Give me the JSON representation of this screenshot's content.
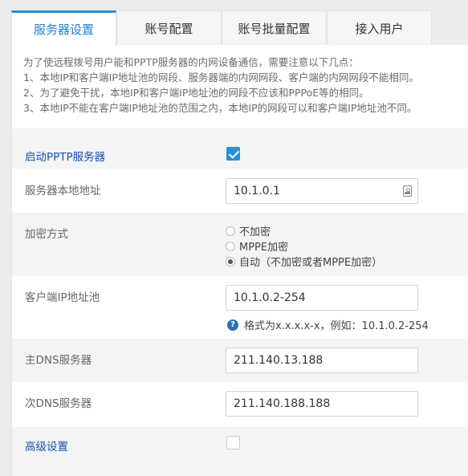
{
  "tabs": [
    {
      "label": "服务器设置",
      "active": true
    },
    {
      "label": "账号配置",
      "active": false
    },
    {
      "label": "账号批量配置",
      "active": false
    },
    {
      "label": "接入用户",
      "active": false
    }
  ],
  "notice": {
    "line0": "为了使远程拨号用户能和PPTP服务器的内网设备通信，需要注意以下几点：",
    "line1": "1、本地IP和客户端IP地址池的网段、服务器端的内网网段、客户端的内网网段不能相同。",
    "line2": "2、为了避免干扰，本地IP和客户端IP地址池的网段不应该和PPPoE等的相同。",
    "line3": "3、本地IP不能在客户端IP地址池的范围之内，本地IP的网段可以和客户端IP地址池不同。"
  },
  "form": {
    "enable_pptp": {
      "label": "启动PPTP服务器",
      "checked": true
    },
    "server_local_ip": {
      "label": "服务器本地地址",
      "value": "10.1.0.1",
      "icon": "contact-card-icon"
    },
    "encryption": {
      "label": "加密方式",
      "options": [
        "不加密",
        "MPPE加密",
        "自动（不加密或者MPPE加密）"
      ],
      "selected": "自动（不加密或者MPPE加密）"
    },
    "client_ip_pool": {
      "label": "客户端IP地址池",
      "value": "10.1.0.2-254",
      "hint": "格式为x.x.x.x-x，例如：10.1.0.2-254",
      "hint_icon": "?"
    },
    "primary_dns": {
      "label": "主DNS服务器",
      "value": "211.140.13.188"
    },
    "secondary_dns": {
      "label": "次DNS服务器",
      "value": "211.140.188.188"
    },
    "advanced": {
      "label": "高级设置",
      "checked": false
    }
  },
  "colors": {
    "accent": "#2b8ed8",
    "label_blue": "#1a4fb0",
    "row_shade": "#f4f4f4"
  }
}
